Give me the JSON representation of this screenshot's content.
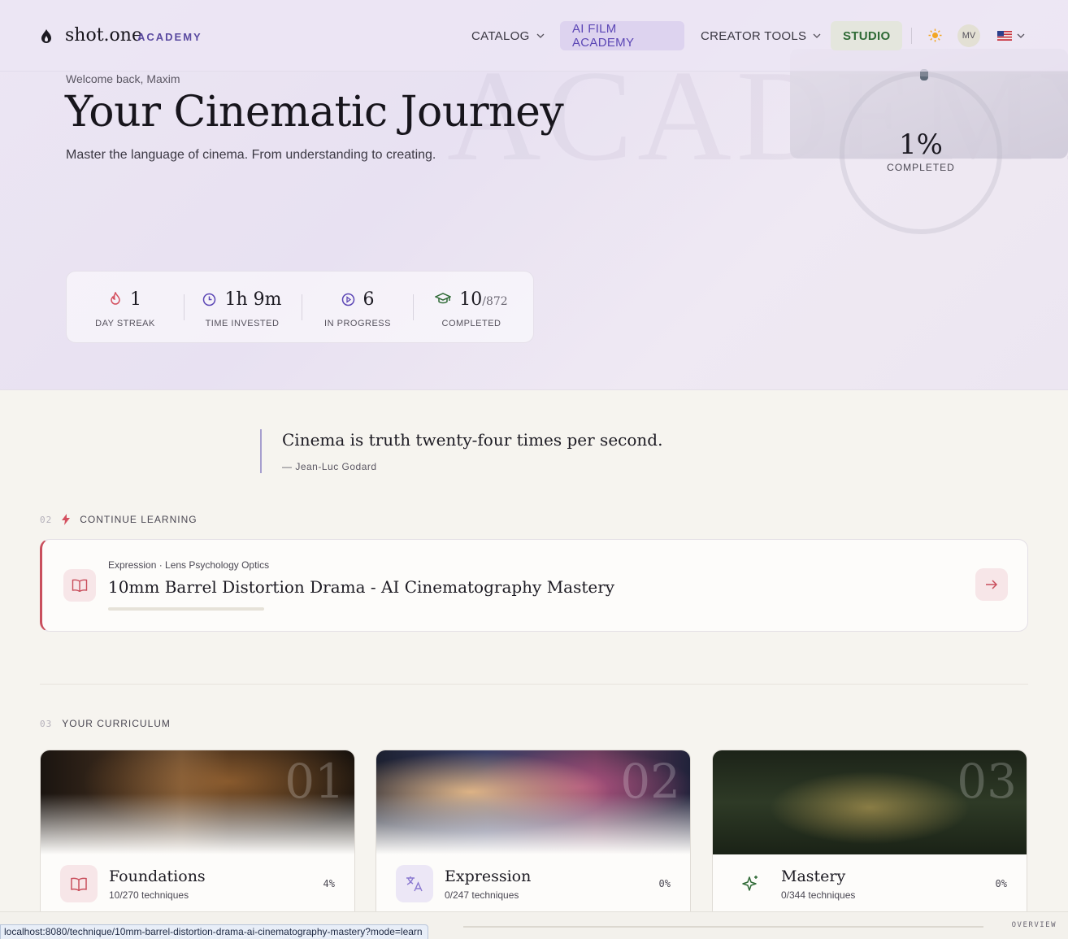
{
  "nav": {
    "logo_text": "shot.one",
    "logo_suffix": "ACADEMY",
    "items": [
      {
        "label": "CATALOG"
      },
      {
        "label": "AI FILM ACADEMY"
      },
      {
        "label": "CREATOR TOOLS"
      },
      {
        "label": "STUDIO"
      }
    ],
    "avatar_initials": "MV",
    "theme_icon": "sun-icon",
    "flag_icon": "us-flag-icon"
  },
  "hero": {
    "watermark": "ACADEMY",
    "welcome": "Welcome back, Maxim",
    "title": "Your Cinematic Journey",
    "subtitle": "Master the language of cinema. From understanding to creating.",
    "overall_progress": "1%",
    "overall_label": "COMPLETED"
  },
  "stats": [
    {
      "icon": "flame-icon",
      "value": "1",
      "label": "DAY STREAK"
    },
    {
      "icon": "clock-icon",
      "value": "1h 9m",
      "label": "TIME INVESTED"
    },
    {
      "icon": "play-circle-icon",
      "value": "6",
      "label": "IN PROGRESS"
    },
    {
      "icon": "graduation-cap-icon",
      "value": "10",
      "total": "/872",
      "label": "COMPLETED"
    }
  ],
  "quote": {
    "text": "Cinema is truth twenty-four times per second.",
    "author": "— Jean-Luc Godard"
  },
  "continue": {
    "section_num": "02",
    "section_label": "CONTINUE LEARNING",
    "meta": "Expression · Lens Psychology Optics",
    "title": "10mm Barrel Distortion Drama - AI Cinematography Mastery"
  },
  "curriculum": {
    "section_num": "03",
    "section_label": "YOUR CURRICULUM",
    "cards": [
      {
        "num": "01",
        "title": "Foundations",
        "sub": "10/270 techniques",
        "pct": "4%",
        "icon": "book-open-icon"
      },
      {
        "num": "02",
        "title": "Expression",
        "sub": "0/247 techniques",
        "pct": "0%",
        "icon": "translate-icon"
      },
      {
        "num": "03",
        "title": "Mastery",
        "sub": "0/344 techniques",
        "pct": "0%",
        "icon": "sparkle-icon"
      }
    ]
  },
  "status": {
    "url": "localhost:8080/technique/10mm-barrel-distortion-drama-ai-cinematography-mastery?mode=learn",
    "overview": "OVERVIEW"
  },
  "colors": {
    "accent_purple": "#5b46b5",
    "accent_red": "#c94f5d",
    "accent_green": "#2f6a36",
    "background": "#f6f4ef"
  }
}
